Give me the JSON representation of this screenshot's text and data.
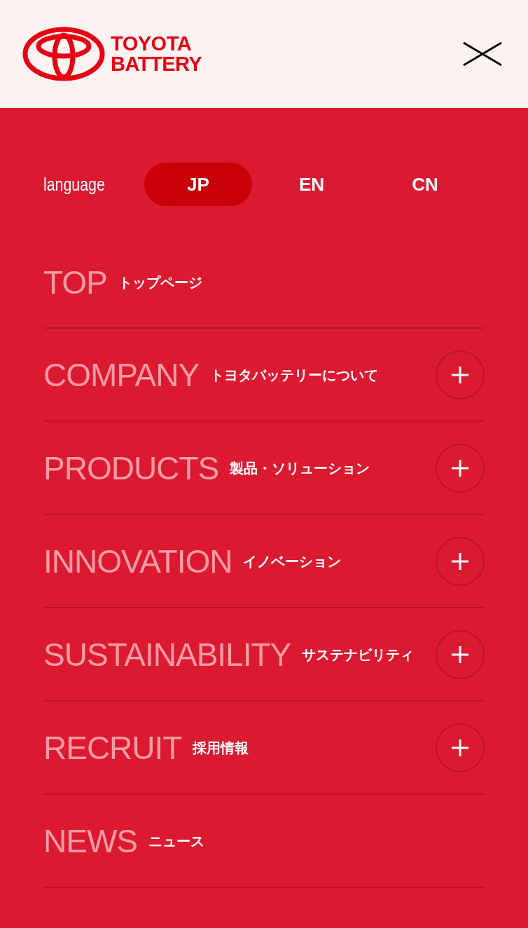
{
  "header": {
    "logo_lines": [
      "TOYOTA",
      "BATTERY"
    ]
  },
  "language": {
    "label": "language",
    "options": [
      {
        "label": "JP",
        "selected": true
      },
      {
        "label": "EN",
        "selected": false
      },
      {
        "label": "CN",
        "selected": false
      }
    ]
  },
  "menu": [
    {
      "title": "TOP",
      "subtitle": "トップページ",
      "expandable": false
    },
    {
      "title": "COMPANY",
      "subtitle": "トヨタバッテリーについて",
      "expandable": true
    },
    {
      "title": "PRODUCTS",
      "subtitle": "製品・ソリューション",
      "expandable": true
    },
    {
      "title": "INNOVATION",
      "subtitle": "イノベーション",
      "expandable": true
    },
    {
      "title": "SUSTAINABILITY",
      "subtitle": "サステナビリティ",
      "expandable": true
    },
    {
      "title": "RECRUIT",
      "subtitle": "採用情報",
      "expandable": true
    },
    {
      "title": "NEWS",
      "subtitle": "ニュース",
      "expandable": false
    }
  ]
}
